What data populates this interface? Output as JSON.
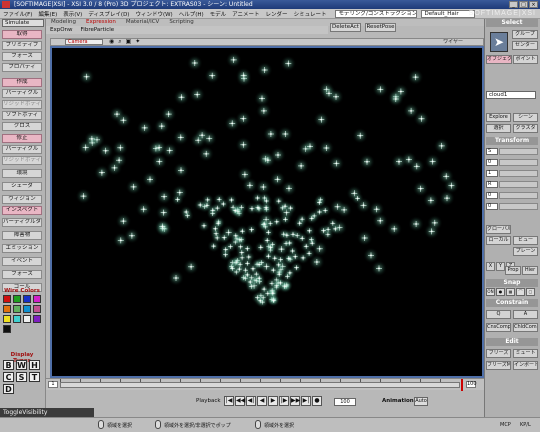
{
  "window": {
    "title": "[SOFTIMAGE|XSI] - XSI 3.0 / 8 (Pro) 3D プロジェクト: EXTRAS03 - シーン: Untitled",
    "controls": [
      "_",
      "□",
      "×"
    ]
  },
  "menubar": {
    "items": [
      "ファイル(F)",
      "編集(E)",
      "表示(V)",
      "ディスプレイ(D)",
      "ウィンドウ(W)",
      "ヘルプ(H)",
      "モデル",
      "アニメート",
      "レンダー",
      "シミュレート"
    ],
    "mode_select": "モデリング/コンストラクションモード",
    "layout_select": "Default_Hair",
    "brand": "SOFTIMAGE|XSI"
  },
  "left_panel": {
    "module_dropdown": "Simulate",
    "buttons": [
      {
        "label": "取得",
        "style": "pink"
      },
      {
        "label": "プリミティブ",
        "style": "normal"
      },
      {
        "label": "フォース",
        "style": "normal"
      },
      {
        "label": "プロパティ",
        "style": "normal"
      },
      {
        "label": "作成",
        "style": "pink"
      },
      {
        "label": "パーティクル",
        "style": "normal"
      },
      {
        "label": "リジッドボディ",
        "style": "disabled"
      },
      {
        "label": "ソフトボディ",
        "style": "normal"
      },
      {
        "label": "クロス",
        "style": "normal"
      },
      {
        "label": "修正",
        "style": "pink"
      },
      {
        "label": "パーティクル",
        "style": "normal"
      },
      {
        "label": "リジッドボディ",
        "style": "disabled"
      },
      {
        "label": "環境",
        "style": "normal"
      },
      {
        "label": "シェーダ",
        "style": "normal"
      },
      {
        "label": "ヴィジョン",
        "style": "normal"
      },
      {
        "label": "インスペクト",
        "style": "pink"
      },
      {
        "label": "パーティクルタイプ",
        "style": "normal"
      },
      {
        "label": "障害物",
        "style": "normal"
      },
      {
        "label": "エミッション",
        "style": "normal"
      },
      {
        "label": "イベント",
        "style": "normal"
      },
      {
        "label": "フォース",
        "style": "normal"
      },
      {
        "label": "ゴール",
        "style": "normal"
      }
    ],
    "wire_colors_title": "Wire Colors",
    "wire_colors": [
      "#d01010",
      "#20a020",
      "#1830c8",
      "#d020c8",
      "#e07010",
      "#60b060",
      "#1090d0",
      "#c05090",
      "#f0e020",
      "#40d0d0",
      "#f0f0f0",
      "#8020c0",
      "#101010"
    ],
    "display_types_title": "Display Types",
    "display_types": [
      "B",
      "W",
      "H",
      "C",
      "S",
      "T",
      "D"
    ]
  },
  "tabs": {
    "main": [
      "Modeling",
      "Expression",
      "Material/ICV",
      "Scripting"
    ],
    "active_index": 1,
    "sub": [
      "ExpOnw",
      "FibreParticle"
    ],
    "buttons": [
      "DeleteAct",
      "ResetPose"
    ]
  },
  "viewport": {
    "camera": "Camera",
    "label": "ワイヤー",
    "icons": [
      "eye-icon",
      "zoom-icon",
      "camera-icon",
      "light-icon"
    ],
    "background": "#000000",
    "particle_color": "#d8fff0",
    "glow_color": "#7fd6b4"
  },
  "timeline": {
    "start_frame": "1",
    "end_frame": "100",
    "end_frame_2": "100"
  },
  "playback": {
    "label": "Playback",
    "buttons": [
      "|◀",
      "◀◀",
      "◀|",
      "◀",
      "▶",
      "|▶",
      "▶▶",
      "▶|",
      "●"
    ],
    "current_frame": "100",
    "animation_label": "Animation",
    "auto_label": "Auto"
  },
  "toggle_field": "ToggleVisibility",
  "status": {
    "left_mouse": "領域を選択",
    "middle_mouse": "領域外を選択/非選択でポップ",
    "right_mouse": "領域外を選択",
    "right_label": "MCP",
    "right_label_2": "KP/L"
  },
  "right_panel": {
    "select_title": "Select",
    "select_buttons": [
      "グループ",
      "センター",
      "オブジェクト",
      "ポイント"
    ],
    "object_name": "cloud1",
    "explore_buttons": [
      "Explore",
      "シーン",
      "選択",
      "クラスタ"
    ],
    "transform_title": "Transform",
    "transform_rows": [
      "S",
      "0",
      "1",
      "R",
      "0",
      "0",
      "T",
      "0",
      "0"
    ],
    "transform_buttons": [
      "グローバル",
      "ビュー",
      "ローカル",
      "プレーン"
    ],
    "transform_extra": [
      "X",
      "Y",
      "Z",
      "Prop",
      "Hier"
    ],
    "snap_title": "Snap",
    "snap_on": "ON",
    "constrain_title": "Constrain",
    "constrain_buttons": [
      "Q",
      "A",
      "CnsComp",
      "ChldComp"
    ],
    "edit_title": "Edit",
    "edit_buttons": [
      "フリーズ",
      "ミュート",
      "フリーズM",
      "インポート/エク..."
    ]
  }
}
